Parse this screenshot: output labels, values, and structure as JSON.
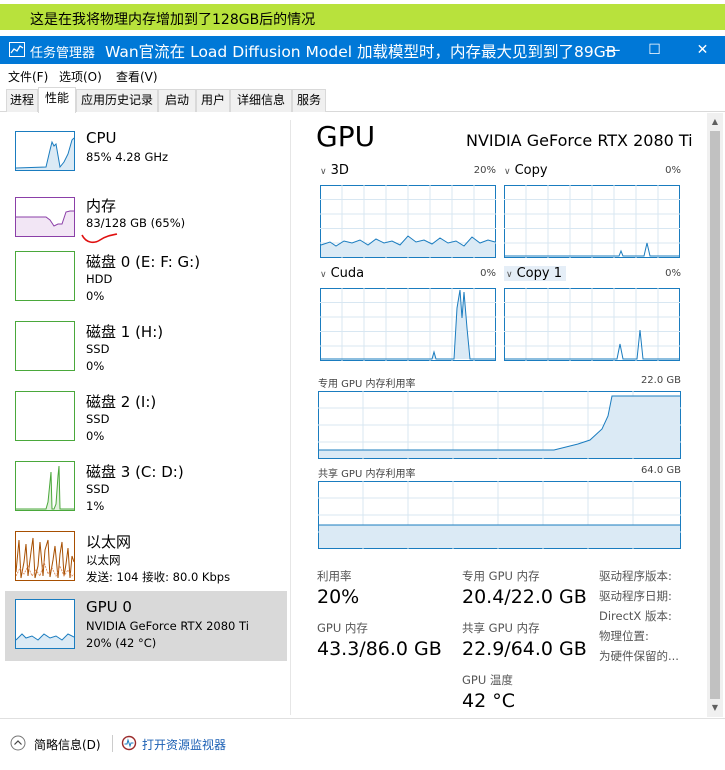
{
  "annotation_banner": "这是在我将物理内存增加到了128GB后的情况",
  "window": {
    "title": "任务管理器",
    "overlay_note": "Wan官流在 Load Diffusion Model 加载模型时，内存最大见到到了89GB",
    "minimize": "—",
    "maximize": "☐",
    "close": "✕"
  },
  "menu": [
    "文件(F)",
    "选项(O)",
    "查看(V)"
  ],
  "tabs": [
    "进程",
    "性能",
    "应用历史记录",
    "启动",
    "用户",
    "详细信息",
    "服务"
  ],
  "resources": [
    {
      "name": "CPU",
      "line1": "85% 4.28 GHz",
      "line2": "",
      "color": "#1a7cbf"
    },
    {
      "name": "内存",
      "line1": "83/128 GB (65%)",
      "line2": "",
      "color": "#8b3fa8"
    },
    {
      "name": "磁盘 0 (E: F: G:)",
      "line1": "HDD",
      "line2": "0%",
      "color": "#4aa83b"
    },
    {
      "name": "磁盘 1 (H:)",
      "line1": "SSD",
      "line2": "0%",
      "color": "#4aa83b"
    },
    {
      "name": "磁盘 2 (I:)",
      "line1": "SSD",
      "line2": "0%",
      "color": "#4aa83b"
    },
    {
      "name": "磁盘 3 (C: D:)",
      "line1": "SSD",
      "line2": "1%",
      "color": "#4aa83b"
    },
    {
      "name": "以太网",
      "line1": "以太网",
      "line2": "发送: 104  接收: 80.0 Kbps",
      "color": "#a74f01"
    },
    {
      "name": "GPU 0",
      "line1": "NVIDIA GeForce RTX 2080 Ti",
      "line2": "20% (42 °C)",
      "color": "#1a7cbf"
    }
  ],
  "gpu": {
    "title": "GPU",
    "model": "NVIDIA GeForce RTX 2080 Ti",
    "engines": [
      {
        "name": "3D",
        "pct": "20%"
      },
      {
        "name": "Copy",
        "pct": "0%"
      },
      {
        "name": "Cuda",
        "pct": "0%"
      },
      {
        "name": "Copy 1",
        "pct": "0%"
      }
    ],
    "dedicated_label": "专用 GPU 内存利用率",
    "dedicated_max": "22.0 GB",
    "shared_label": "共享 GPU 内存利用率",
    "shared_max": "64.0 GB",
    "stats": {
      "util_label": "利用率",
      "util_value": "20%",
      "gpumem_label": "GPU 内存",
      "gpumem_value": "43.3/86.0 GB",
      "ded_label": "专用 GPU 内存",
      "ded_value": "20.4/22.0 GB",
      "shared_label": "共享 GPU 内存",
      "shared_value": "22.9/64.0 GB",
      "temp_label": "GPU 温度",
      "temp_value": "42 °C"
    },
    "info_labels": [
      "驱动程序版本:",
      "驱动程序日期:",
      "DirectX 版本:",
      "物理位置:",
      "为硬件保留的..."
    ]
  },
  "footer": {
    "brief_label": "简略信息(D)",
    "monitor_label": "打开资源监视器"
  },
  "colors": {
    "titlebar": "#0078d7",
    "banner": "#b8e23c",
    "graph_line": "#1a7cbf",
    "graph_fill": "#dbeaf5",
    "graph_grid": "#d8e7f2",
    "selection": "#d9d9d9"
  }
}
